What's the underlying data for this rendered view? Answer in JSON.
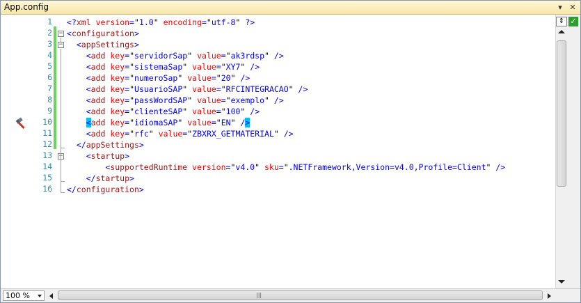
{
  "window": {
    "title": "App.config"
  },
  "titlebar": {
    "dropdown_glyph": "▾",
    "close_glyph": "✕"
  },
  "editor": {
    "lines": [
      {
        "n": "1",
        "tokens": [
          {
            "c": "bl",
            "t": "<?"
          },
          {
            "c": "el",
            "t": "xml"
          },
          {
            "c": "pl",
            "t": " "
          },
          {
            "c": "at",
            "t": "version"
          },
          {
            "c": "bl",
            "t": "="
          },
          {
            "c": "pl",
            "t": "\""
          },
          {
            "c": "bl",
            "t": "1.0"
          },
          {
            "c": "pl",
            "t": "\""
          },
          {
            "c": "pl",
            "t": " "
          },
          {
            "c": "at",
            "t": "encoding"
          },
          {
            "c": "bl",
            "t": "="
          },
          {
            "c": "pl",
            "t": "\""
          },
          {
            "c": "bl",
            "t": "utf-8"
          },
          {
            "c": "pl",
            "t": "\""
          },
          {
            "c": "pl",
            "t": " "
          },
          {
            "c": "bl",
            "t": "?>"
          }
        ]
      },
      {
        "n": "2",
        "tokens": [
          {
            "c": "bl",
            "t": "<"
          },
          {
            "c": "el",
            "t": "configuration"
          },
          {
            "c": "bl",
            "t": ">"
          }
        ]
      },
      {
        "n": "3",
        "tokens": [
          {
            "c": "pl",
            "t": "  "
          },
          {
            "c": "bl",
            "t": "<"
          },
          {
            "c": "el",
            "t": "appSettings"
          },
          {
            "c": "bl",
            "t": ">"
          }
        ]
      },
      {
        "n": "4",
        "tokens": [
          {
            "c": "pl",
            "t": "    "
          },
          {
            "c": "bl",
            "t": "<"
          },
          {
            "c": "el",
            "t": "add"
          },
          {
            "c": "pl",
            "t": " "
          },
          {
            "c": "at",
            "t": "key"
          },
          {
            "c": "bl",
            "t": "="
          },
          {
            "c": "pl",
            "t": "\""
          },
          {
            "c": "bl",
            "t": "servidorSap"
          },
          {
            "c": "pl",
            "t": "\""
          },
          {
            "c": "pl",
            "t": " "
          },
          {
            "c": "at",
            "t": "value"
          },
          {
            "c": "bl",
            "t": "="
          },
          {
            "c": "pl",
            "t": "\""
          },
          {
            "c": "bl",
            "t": "ak3rdsp"
          },
          {
            "c": "pl",
            "t": "\""
          },
          {
            "c": "pl",
            "t": " "
          },
          {
            "c": "bl",
            "t": "/>"
          }
        ]
      },
      {
        "n": "5",
        "tokens": [
          {
            "c": "pl",
            "t": "    "
          },
          {
            "c": "bl",
            "t": "<"
          },
          {
            "c": "el",
            "t": "add"
          },
          {
            "c": "pl",
            "t": " "
          },
          {
            "c": "at",
            "t": "key"
          },
          {
            "c": "bl",
            "t": "="
          },
          {
            "c": "pl",
            "t": "\""
          },
          {
            "c": "bl",
            "t": "sistemaSap"
          },
          {
            "c": "pl",
            "t": "\""
          },
          {
            "c": "pl",
            "t": " "
          },
          {
            "c": "at",
            "t": "value"
          },
          {
            "c": "bl",
            "t": "="
          },
          {
            "c": "pl",
            "t": "\""
          },
          {
            "c": "bl",
            "t": "XY7"
          },
          {
            "c": "pl",
            "t": "\""
          },
          {
            "c": "pl",
            "t": " "
          },
          {
            "c": "bl",
            "t": "/>"
          }
        ]
      },
      {
        "n": "6",
        "tokens": [
          {
            "c": "pl",
            "t": "    "
          },
          {
            "c": "bl",
            "t": "<"
          },
          {
            "c": "el",
            "t": "add"
          },
          {
            "c": "pl",
            "t": " "
          },
          {
            "c": "at",
            "t": "key"
          },
          {
            "c": "bl",
            "t": "="
          },
          {
            "c": "pl",
            "t": "\""
          },
          {
            "c": "bl",
            "t": "numeroSap"
          },
          {
            "c": "pl",
            "t": "\""
          },
          {
            "c": "pl",
            "t": " "
          },
          {
            "c": "at",
            "t": "value"
          },
          {
            "c": "bl",
            "t": "="
          },
          {
            "c": "pl",
            "t": "\""
          },
          {
            "c": "bl",
            "t": "20"
          },
          {
            "c": "pl",
            "t": "\""
          },
          {
            "c": "pl",
            "t": " "
          },
          {
            "c": "bl",
            "t": "/>"
          }
        ]
      },
      {
        "n": "7",
        "tokens": [
          {
            "c": "pl",
            "t": "    "
          },
          {
            "c": "bl",
            "t": "<"
          },
          {
            "c": "el",
            "t": "add"
          },
          {
            "c": "pl",
            "t": " "
          },
          {
            "c": "at",
            "t": "key"
          },
          {
            "c": "bl",
            "t": "="
          },
          {
            "c": "pl",
            "t": "\""
          },
          {
            "c": "bl",
            "t": "UsuarioSAP"
          },
          {
            "c": "pl",
            "t": "\""
          },
          {
            "c": "pl",
            "t": " "
          },
          {
            "c": "at",
            "t": "value"
          },
          {
            "c": "bl",
            "t": "="
          },
          {
            "c": "pl",
            "t": "\""
          },
          {
            "c": "bl",
            "t": "RFCINTEGRACAO"
          },
          {
            "c": "pl",
            "t": "\""
          },
          {
            "c": "pl",
            "t": " "
          },
          {
            "c": "bl",
            "t": "/>"
          }
        ]
      },
      {
        "n": "8",
        "tokens": [
          {
            "c": "pl",
            "t": "    "
          },
          {
            "c": "bl",
            "t": "<"
          },
          {
            "c": "el",
            "t": "add"
          },
          {
            "c": "pl",
            "t": " "
          },
          {
            "c": "at",
            "t": "key"
          },
          {
            "c": "bl",
            "t": "="
          },
          {
            "c": "pl",
            "t": "\""
          },
          {
            "c": "bl",
            "t": "passWordSAP"
          },
          {
            "c": "pl",
            "t": "\""
          },
          {
            "c": "pl",
            "t": " "
          },
          {
            "c": "at",
            "t": "value"
          },
          {
            "c": "bl",
            "t": "="
          },
          {
            "c": "pl",
            "t": "\""
          },
          {
            "c": "bl",
            "t": "exemplo"
          },
          {
            "c": "pl",
            "t": "\""
          },
          {
            "c": "pl",
            "t": " "
          },
          {
            "c": "bl",
            "t": "/>"
          }
        ]
      },
      {
        "n": "9",
        "tokens": [
          {
            "c": "pl",
            "t": "    "
          },
          {
            "c": "bl",
            "t": "<"
          },
          {
            "c": "el",
            "t": "add"
          },
          {
            "c": "pl",
            "t": " "
          },
          {
            "c": "at",
            "t": "key"
          },
          {
            "c": "bl",
            "t": "="
          },
          {
            "c": "pl",
            "t": "\""
          },
          {
            "c": "bl",
            "t": "clienteSAP"
          },
          {
            "c": "pl",
            "t": "\""
          },
          {
            "c": "pl",
            "t": " "
          },
          {
            "c": "at",
            "t": "value"
          },
          {
            "c": "bl",
            "t": "="
          },
          {
            "c": "pl",
            "t": "\""
          },
          {
            "c": "bl",
            "t": "100"
          },
          {
            "c": "pl",
            "t": "\""
          },
          {
            "c": "pl",
            "t": " "
          },
          {
            "c": "bl",
            "t": "/>"
          }
        ]
      },
      {
        "n": "10",
        "tokens": [
          {
            "c": "pl",
            "t": "    "
          },
          {
            "c": "bl hl",
            "t": "<"
          },
          {
            "c": "el",
            "t": "add"
          },
          {
            "c": "pl",
            "t": " "
          },
          {
            "c": "at",
            "t": "key"
          },
          {
            "c": "bl",
            "t": "="
          },
          {
            "c": "pl",
            "t": "\""
          },
          {
            "c": "bl",
            "t": "idiomaSAP"
          },
          {
            "c": "pl",
            "t": "\""
          },
          {
            "c": "pl",
            "t": " "
          },
          {
            "c": "at",
            "t": "value"
          },
          {
            "c": "bl",
            "t": "="
          },
          {
            "c": "pl",
            "t": "\""
          },
          {
            "c": "bl",
            "t": "EN"
          },
          {
            "c": "pl",
            "t": "\""
          },
          {
            "c": "pl",
            "t": " "
          },
          {
            "c": "bl",
            "t": "/"
          },
          {
            "c": "bl hl",
            "t": ">"
          }
        ]
      },
      {
        "n": "11",
        "tokens": [
          {
            "c": "pl",
            "t": "    "
          },
          {
            "c": "bl",
            "t": "<"
          },
          {
            "c": "el",
            "t": "add"
          },
          {
            "c": "pl",
            "t": " "
          },
          {
            "c": "at",
            "t": "key"
          },
          {
            "c": "bl",
            "t": "="
          },
          {
            "c": "pl",
            "t": "\""
          },
          {
            "c": "bl",
            "t": "rfc"
          },
          {
            "c": "pl",
            "t": "\""
          },
          {
            "c": "pl",
            "t": " "
          },
          {
            "c": "at",
            "t": "value"
          },
          {
            "c": "bl",
            "t": "="
          },
          {
            "c": "pl",
            "t": "\""
          },
          {
            "c": "bl",
            "t": "ZBXRX_GETMATERIAL"
          },
          {
            "c": "pl",
            "t": "\""
          },
          {
            "c": "pl",
            "t": " "
          },
          {
            "c": "bl",
            "t": "/>"
          }
        ]
      },
      {
        "n": "12",
        "tokens": [
          {
            "c": "pl",
            "t": "  "
          },
          {
            "c": "bl",
            "t": "</"
          },
          {
            "c": "el",
            "t": "appSettings"
          },
          {
            "c": "bl",
            "t": ">"
          }
        ]
      },
      {
        "n": "13",
        "tokens": [
          {
            "c": "pl",
            "t": "    "
          },
          {
            "c": "bl",
            "t": "<"
          },
          {
            "c": "el",
            "t": "startup"
          },
          {
            "c": "bl",
            "t": ">"
          }
        ]
      },
      {
        "n": "14",
        "tokens": [
          {
            "c": "pl",
            "t": "        "
          },
          {
            "c": "bl",
            "t": "<"
          },
          {
            "c": "el",
            "t": "supportedRuntime"
          },
          {
            "c": "pl",
            "t": " "
          },
          {
            "c": "at",
            "t": "version"
          },
          {
            "c": "bl",
            "t": "="
          },
          {
            "c": "pl",
            "t": "\""
          },
          {
            "c": "bl",
            "t": "v4.0"
          },
          {
            "c": "pl",
            "t": "\""
          },
          {
            "c": "pl",
            "t": " "
          },
          {
            "c": "at",
            "t": "sku"
          },
          {
            "c": "bl",
            "t": "="
          },
          {
            "c": "pl",
            "t": "\""
          },
          {
            "c": "bl",
            "t": ".NETFramework,Version=v4.0,Profile=Client"
          },
          {
            "c": "pl",
            "t": "\""
          },
          {
            "c": "pl",
            "t": " "
          },
          {
            "c": "bl",
            "t": "/>"
          }
        ]
      },
      {
        "n": "15",
        "tokens": [
          {
            "c": "pl",
            "t": "    "
          },
          {
            "c": "bl",
            "t": "</"
          },
          {
            "c": "el",
            "t": "startup"
          },
          {
            "c": "bl",
            "t": ">"
          }
        ]
      },
      {
        "n": "16",
        "tokens": [
          {
            "c": "bl",
            "t": "</"
          },
          {
            "c": "el",
            "t": "configuration"
          },
          {
            "c": "bl",
            "t": ">"
          }
        ]
      }
    ],
    "colors": {
      "line_number": "#2b91af",
      "change_bar": "#6cd45c",
      "brace_highlight": "#00bfff"
    }
  },
  "glyphs": {
    "breakpoint_icon": "hammer-icon"
  },
  "statusbar": {
    "zoom": "100 %",
    "hscroll_grip": "|||"
  }
}
